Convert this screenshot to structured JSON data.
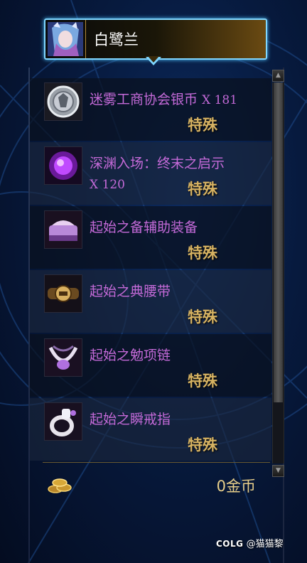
{
  "header": {
    "character_name": "白鹭兰"
  },
  "items": [
    {
      "icon": "silver-coin-icon",
      "name": "迷雾工商协会银币",
      "quantity": "X 181",
      "tag": "特殊"
    },
    {
      "icon": "purple-orb-icon",
      "name": "深渊入场：终末之启示",
      "quantity": "X 120",
      "tag": "特殊"
    },
    {
      "icon": "auxiliary-equipment-icon",
      "name": "起始之备辅助装备",
      "quantity": "",
      "tag": "特殊"
    },
    {
      "icon": "belt-icon",
      "name": "起始之典腰带",
      "quantity": "",
      "tag": "特殊"
    },
    {
      "icon": "necklace-icon",
      "name": "起始之勉项链",
      "quantity": "",
      "tag": "特殊"
    },
    {
      "icon": "ring-icon",
      "name": "起始之瞬戒指",
      "quantity": "",
      "tag": "特殊"
    }
  ],
  "gold": {
    "amount": "0金币"
  },
  "watermark": {
    "brand": "COLG",
    "handle": "@猫猫黎"
  },
  "colors": {
    "frame_accent": "#7fd6ff",
    "item_name": "#c46ad8",
    "tag_gold": "#d6b262"
  }
}
